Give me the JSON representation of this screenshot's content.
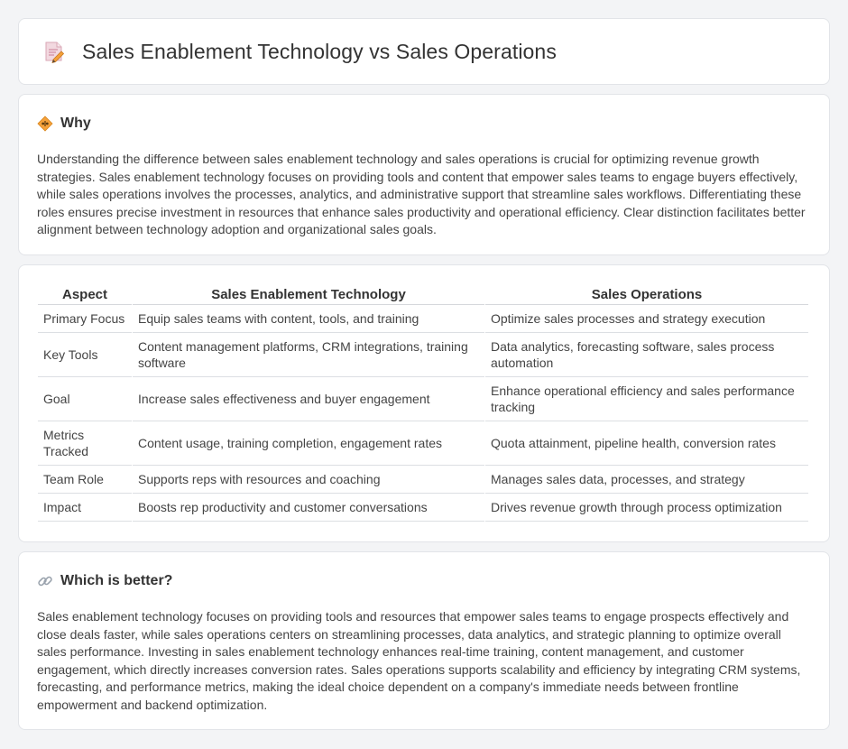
{
  "header": {
    "title": "Sales Enablement Technology vs Sales Operations",
    "icon": "document-pencil-icon"
  },
  "why": {
    "icon": "diamond-icon",
    "heading": "Why",
    "text": "Understanding the difference between sales enablement technology and sales operations is crucial for optimizing revenue growth strategies. Sales enablement technology focuses on providing tools and content that empower sales teams to engage buyers effectively, while sales operations involves the processes, analytics, and administrative support that streamline sales workflows. Differentiating these roles ensures precise investment in resources that enhance sales productivity and operational efficiency. Clear distinction facilitates better alignment between technology adoption and organizational sales goals."
  },
  "comparison": {
    "headers": [
      "Aspect",
      "Sales Enablement Technology",
      "Sales Operations"
    ],
    "rows": [
      [
        "Primary Focus",
        "Equip sales teams with content, tools, and training",
        "Optimize sales processes and strategy execution"
      ],
      [
        "Key Tools",
        "Content management platforms, CRM integrations, training software",
        "Data analytics, forecasting software, sales process automation"
      ],
      [
        "Goal",
        "Increase sales effectiveness and buyer engagement",
        "Enhance operational efficiency and sales performance tracking"
      ],
      [
        "Metrics Tracked",
        "Content usage, training completion, engagement rates",
        "Quota attainment, pipeline health, conversion rates"
      ],
      [
        "Team Role",
        "Supports reps with resources and coaching",
        "Manages sales data, processes, and strategy"
      ],
      [
        "Impact",
        "Boosts rep productivity and customer conversations",
        "Drives revenue growth through process optimization"
      ]
    ]
  },
  "better": {
    "icon": "link-icon",
    "heading": "Which is better?",
    "text": "Sales enablement technology focuses on providing tools and resources that empower sales teams to engage prospects effectively and close deals faster, while sales operations centers on streamlining processes, data analytics, and strategic planning to optimize overall sales performance. Investing in sales enablement technology enhances real-time training, content management, and customer engagement, which directly increases conversion rates. Sales operations supports scalability and efficiency by integrating CRM systems, forecasting, and performance metrics, making the ideal choice dependent on a company's immediate needs between frontline empowerment and backend optimization."
  },
  "colors": {
    "background": "#f3f4f6",
    "card": "#ffffff",
    "icon_orange": "#f4a13a",
    "icon_pink": "#e7a7b8"
  }
}
